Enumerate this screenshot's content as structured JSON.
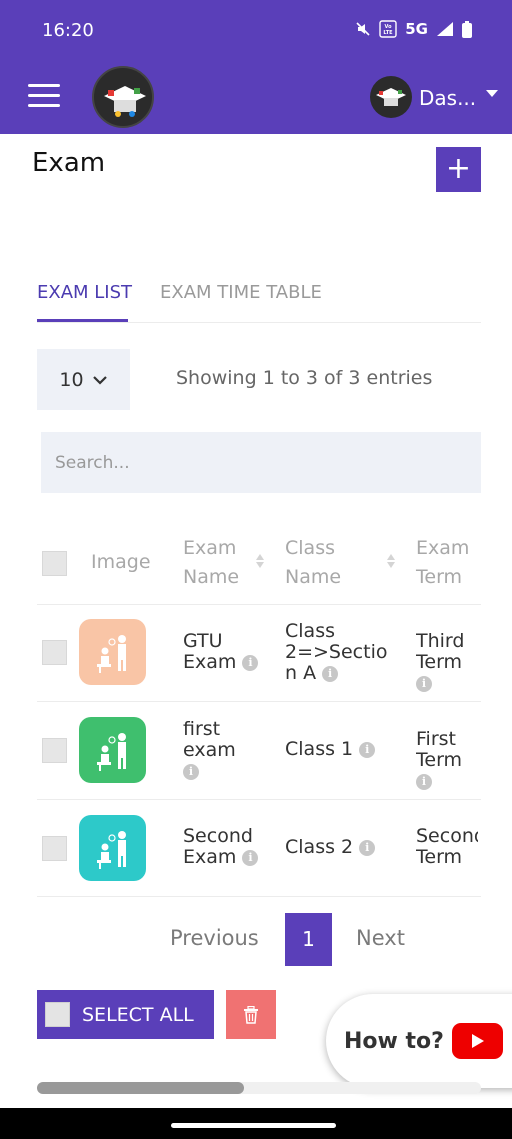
{
  "status": {
    "time": "16:20",
    "network": "5G"
  },
  "header": {
    "user_name": "Das..."
  },
  "page": {
    "title": "Exam",
    "add_label": "+"
  },
  "tabs": [
    {
      "label": "EXAM LIST",
      "active": true
    },
    {
      "label": "EXAM TIME TABLE",
      "active": false
    }
  ],
  "controls": {
    "page_size": "10",
    "entries_info": "Showing 1 to 3 of 3 entries",
    "search_placeholder": "Search..."
  },
  "table": {
    "columns": [
      "Image",
      "Exam Name",
      "Class Name",
      "Exam Term"
    ],
    "rows": [
      {
        "exam_name": "GTU Exam",
        "class_name": "Class 2=>Section A",
        "exam_term": "Third Term",
        "thumb_color": "#f9c5a6"
      },
      {
        "exam_name": "first exam",
        "class_name": "Class 1",
        "exam_term": "First Term",
        "thumb_color": "#3fbf6e"
      },
      {
        "exam_name": "Second Exam",
        "class_name": "Class 2",
        "exam_term": "Second Term",
        "thumb_color": "#2dc9c9"
      }
    ]
  },
  "pagination": {
    "previous": "Previous",
    "current": "1",
    "next": "Next"
  },
  "actions": {
    "select_all": "SELECT ALL"
  },
  "help": {
    "label": "How to?"
  },
  "colors": {
    "primary": "#5a3fb9",
    "danger": "#f07272",
    "youtube": "#ee0000"
  }
}
